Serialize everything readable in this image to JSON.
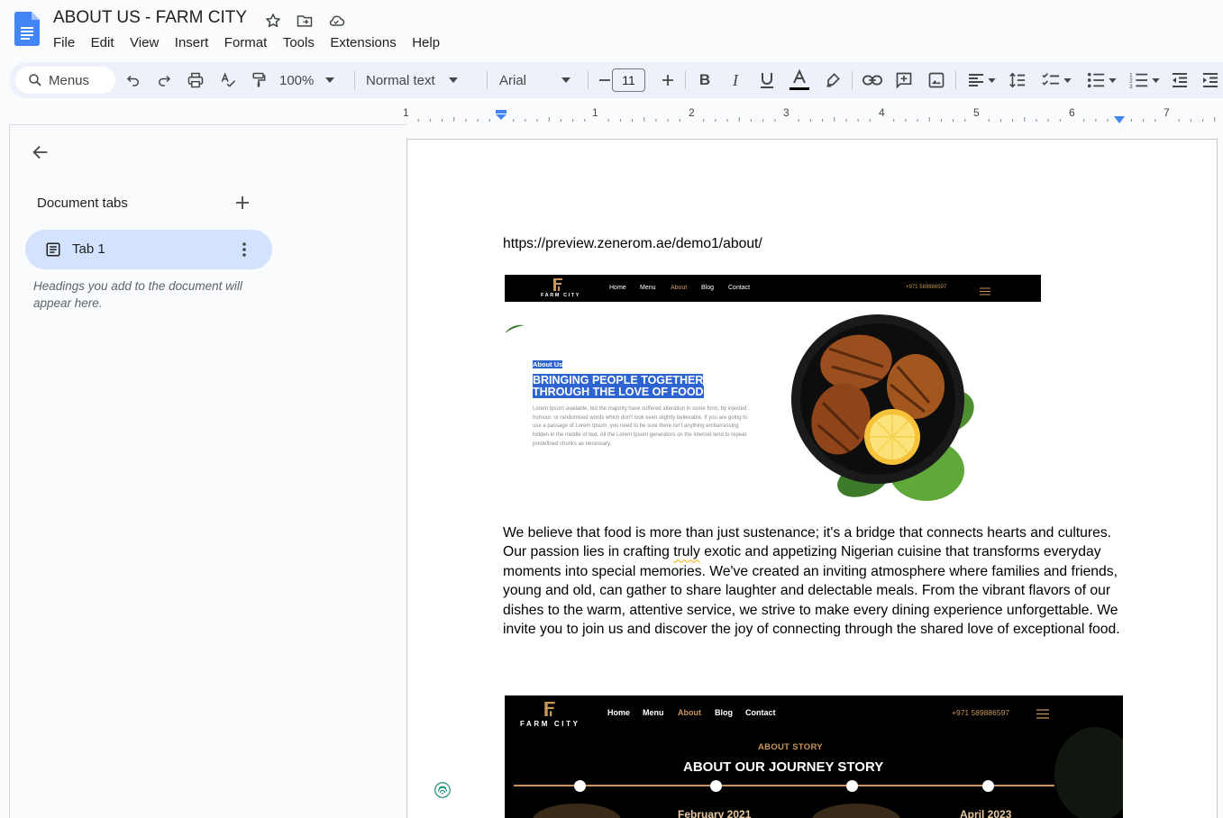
{
  "app": {
    "doc_title": "ABOUT US - FARM CITY",
    "menus": [
      "File",
      "Edit",
      "View",
      "Insert",
      "Format",
      "Tools",
      "Extensions",
      "Help"
    ]
  },
  "toolbar": {
    "search_placeholder": "Menus",
    "zoom": "100%",
    "style": "Normal text",
    "font": "Arial",
    "font_size": "11"
  },
  "ruler": {
    "labels": [
      "1",
      "1",
      "2",
      "3",
      "4",
      "5",
      "6",
      "7"
    ]
  },
  "sidebar": {
    "header": "Document tabs",
    "tab_label": "Tab 1",
    "hint": "Headings you add to the document will appear here."
  },
  "document": {
    "url_line": "https://preview.zenerom.ae/demo1/about/",
    "para_before": "We believe that food is more than just sustenance; it's a bridge that connects hearts and cultures. Our passion lies in crafting ",
    "para_squiggle": "truly",
    "para_after": " exotic and appetizing Nigerian cuisine that transforms everyday moments into special memories. We've created an inviting atmosphere where families and friends, young and old, can gather to share laughter and delectable meals. From the vibrant flavors of our dishes to the warm, attentive service, we strive to make every dining experience unforgettable. We invite you to join us and discover the joy of connecting through the shared love of exceptional food."
  },
  "screenshot1": {
    "brand": "FARM CITY",
    "nav": [
      "Home",
      "Menu",
      "About",
      "Blog",
      "Contact"
    ],
    "phone": "+971 589886597",
    "eyebrow": "About Us",
    "heading_line1": "BRINGING PEOPLE TOGETHER",
    "heading_line2": "THROUGH THE LOVE OF FOOD",
    "body": "Lorem Ipsum available, but the majority have suffered alteration in some form, by injected humour, or randomised words which don't look even slightly believable. If you are going to use a passage of Lorem Ipsum, you need to be sure there isn't anything embarrassing hidden in the middle of text. All the Lorem Ipsum generators on the internet tend to repeat predefined chunks as necessary."
  },
  "screenshot2": {
    "brand": "FARM CITY",
    "nav": [
      "Home",
      "Menu",
      "About",
      "Blog",
      "Contact"
    ],
    "phone": "+971 589886597",
    "eyebrow": "ABOUT STORY",
    "heading": "ABOUT OUR JOURNEY STORY",
    "date1": "February 2021",
    "date2": "April 2023"
  },
  "colors": {
    "accent_blue": "#0b57d0",
    "tab_pill": "#d3e3fd",
    "highlight": "#2e64d2",
    "gold": "#c8955a"
  }
}
